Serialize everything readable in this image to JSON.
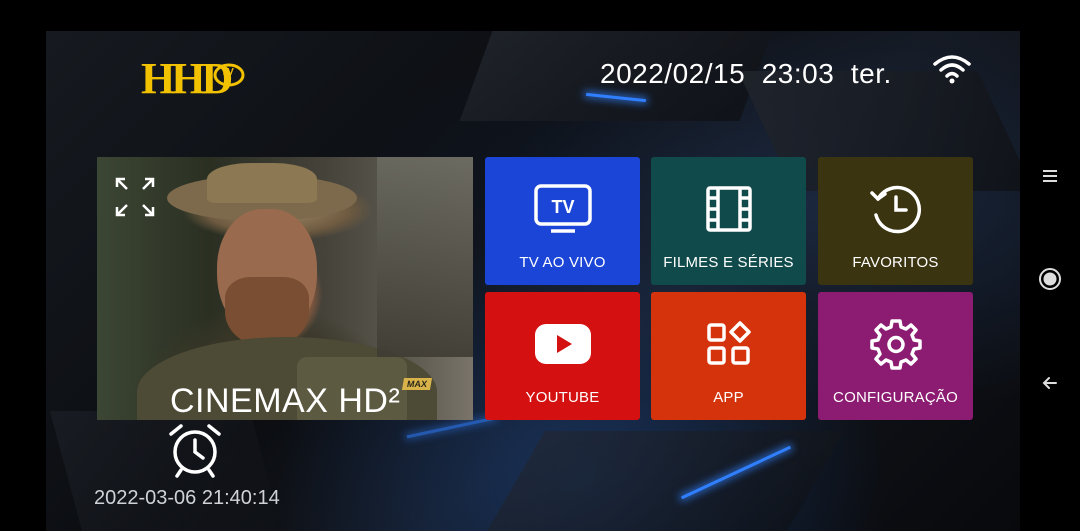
{
  "header": {
    "logo_text": "HD",
    "logo_badge": "TV",
    "date": "2022/02/15",
    "time": "23:03",
    "weekday": "ter."
  },
  "preview": {
    "channel_name": "CINEMAX HD²",
    "watermark": "MAX"
  },
  "schedule": {
    "timestamp": "2022-03-06 21:40:14"
  },
  "tiles": [
    {
      "label": "TV AO VIVO",
      "icon": "tv-icon",
      "color": "#1a45d6"
    },
    {
      "label": "FILMES E SÉRIES",
      "icon": "film-icon",
      "color": "#114a4a"
    },
    {
      "label": "FAVORITOS",
      "icon": "history-icon",
      "color": "#3a3410"
    },
    {
      "label": "YOUTUBE",
      "icon": "youtube-icon",
      "color": "#d41010"
    },
    {
      "label": "APP",
      "icon": "apps-icon",
      "color": "#d5330b"
    },
    {
      "label": "CONFIGURAÇÃO",
      "icon": "gear-icon",
      "color": "#8c1c72"
    }
  ],
  "colors": {
    "logo_gold": "#f2c200",
    "background": "#000000"
  }
}
